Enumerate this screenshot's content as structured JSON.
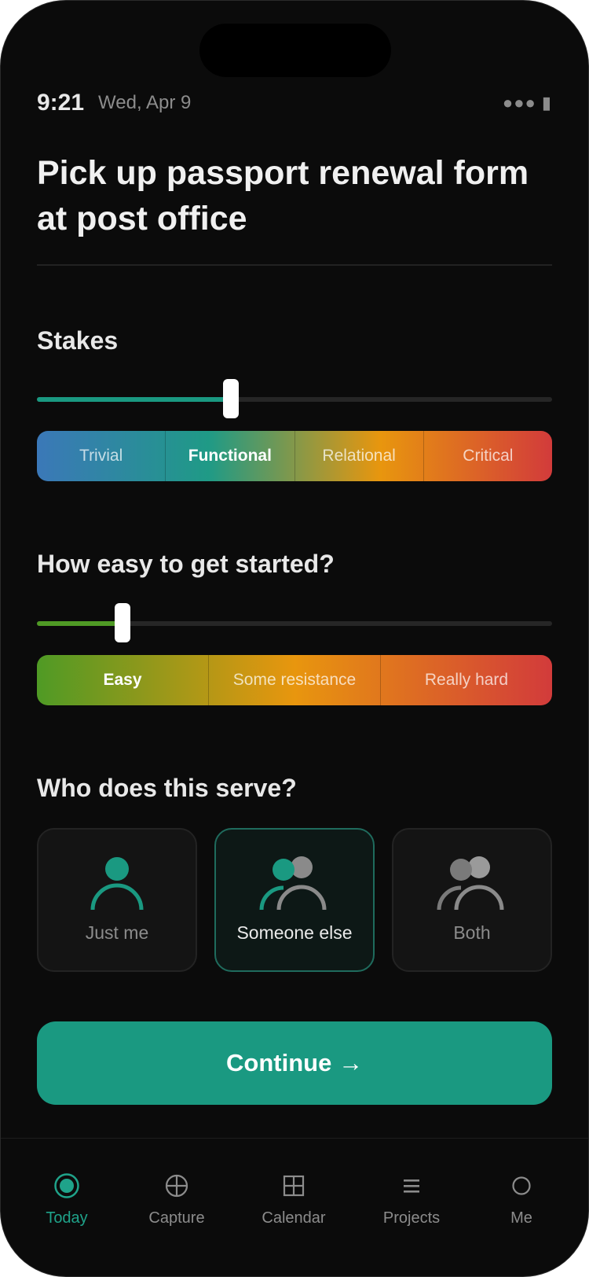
{
  "status": {
    "time": "9:21",
    "date": "Wed, Apr 9",
    "indicators": "●●● ▮"
  },
  "task": {
    "title": "Pick up passport renewal form at post office"
  },
  "stakes": {
    "label": "Stakes",
    "value_fraction": 0.376,
    "options": [
      "Trivial",
      "Functional",
      "Relational",
      "Critical"
    ],
    "selected_index": 1,
    "fill_color": "#1a9981"
  },
  "ease": {
    "label": "How easy to get started?",
    "value_fraction": 0.166,
    "options": [
      "Easy",
      "Some resistance",
      "Really hard"
    ],
    "selected_index": 0,
    "fill_color": "#4f9a25"
  },
  "serve": {
    "label": "Who does this serve?",
    "options": [
      {
        "label": "Just me",
        "icon": "person-icon"
      },
      {
        "label": "Someone else",
        "icon": "people-icon"
      },
      {
        "label": "Both",
        "icon": "group-icon"
      }
    ],
    "selected_index": 1
  },
  "cta": {
    "label": "Continue →"
  },
  "tabbar": {
    "tabs": [
      {
        "label": "Today",
        "icon": "today-icon",
        "active": true
      },
      {
        "label": "Capture",
        "icon": "capture-icon",
        "active": false
      },
      {
        "label": "Calendar",
        "icon": "calendar-icon",
        "active": false
      },
      {
        "label": "Projects",
        "icon": "projects-icon",
        "active": false
      },
      {
        "label": "Me",
        "icon": "me-icon",
        "active": false
      }
    ]
  },
  "colors": {
    "accent": "#1a9981",
    "background": "#0b0b0b",
    "stakes_gradient": [
      "#3b78b8",
      "#1f9a86",
      "#e8960e",
      "#d23b3b"
    ],
    "ease_gradient": [
      "#4f9a25",
      "#e8960e",
      "#d23b3b"
    ]
  }
}
